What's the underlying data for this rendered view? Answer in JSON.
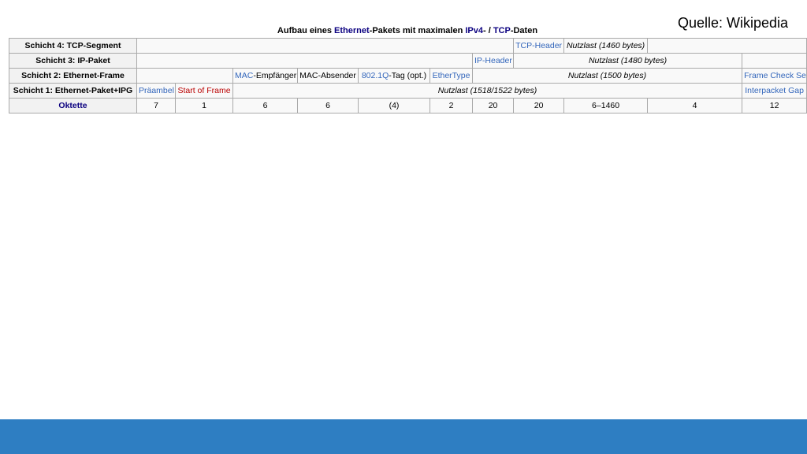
{
  "source_label": "Quelle: Wikipedia",
  "caption": {
    "pre": "Aufbau eines ",
    "ethernet": "Ethernet",
    "mid": "-Pakets mit maximalen ",
    "ipv4": "IPv4",
    "sep": "- / ",
    "tcp": "TCP",
    "post": "-Daten"
  },
  "rows": {
    "layer4": {
      "header": "Schicht 4: TCP-Segment",
      "tcp_header": "TCP-Header",
      "payload": "Nutzlast (1460 bytes)"
    },
    "layer3": {
      "header": "Schicht 3: IP-Paket",
      "ip_header": "IP-Header",
      "payload": "Nutzlast (1480 bytes)"
    },
    "layer2": {
      "header": "Schicht 2: Ethernet-Frame",
      "mac_link": "MAC",
      "mac_dest_rest": "-Empfänger",
      "mac_src": "MAC-Absender",
      "vlan_link": "802.1Q",
      "vlan_rest": "-Tag (opt.)",
      "ethertype": "EtherType",
      "payload": "Nutzlast (1500 bytes)",
      "fcs": "Frame Check Sequence"
    },
    "layer1": {
      "header": "Schicht 1: Ethernet-Paket+IPG",
      "preamble": "Präambel",
      "sof": "Start of Frame",
      "payload": "Nutzlast (1518/1522 bytes)",
      "ipg": "Interpacket Gap"
    },
    "octets": {
      "header": "Oktette",
      "values": [
        "7",
        "1",
        "6",
        "6",
        "(4)",
        "2",
        "20",
        "20",
        "6–1460",
        "4",
        "12"
      ]
    }
  },
  "colors": {
    "footer_bar": "#2e7ec2",
    "footer_line": "#5fb3e6",
    "link": "#3366bb",
    "link_dark": "#0b0080",
    "link_red": "#ba0000"
  }
}
